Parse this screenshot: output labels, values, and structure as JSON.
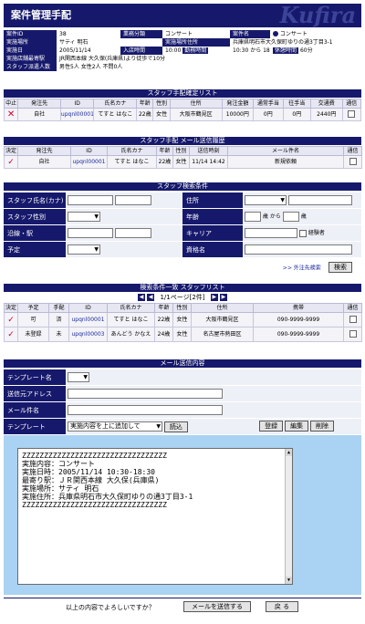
{
  "page": {
    "title": "案件管理手配",
    "logo_text": "Kufira"
  },
  "case_info": {
    "case_id_label": "案件ID",
    "case_id": "38",
    "business_type_label": "業務分類",
    "business_type": "コンサート",
    "case_name_label": "案件名",
    "case_name": "コンサート",
    "venue_label": "実施場所",
    "venue": "サティ 明石",
    "venue_address_label": "実施場所住所",
    "venue_address": "兵庫県明石市大久保町ゆりの通3丁目3-1",
    "date_label": "実施日",
    "date": "2005/11/14",
    "entry_time_label": "入店時間",
    "entry_time": "10:00",
    "work_time_label": "勤務時間",
    "work_time": "10:30 から 18:30",
    "break_time_label": "休憩時間",
    "break_time": "60分",
    "station_label": "実施店舗最寄駅",
    "station": "JR関西本線 大久保(兵庫県)より徒歩で10分",
    "staff_count_label": "スタッフ派遣人数",
    "staff_count": "男性5人 女性2人 不問0人"
  },
  "confirmed_list": {
    "title": "スタッフ手配確定リスト",
    "headers": [
      "中止",
      "発注先",
      "ID",
      "氏名カナ",
      "年齢",
      "性別",
      "住所",
      "発注金額",
      "通常手当",
      "往手当",
      "交通費",
      "通信"
    ],
    "rows": [
      {
        "vendor": "自社",
        "id": "upqnl00001",
        "name": "てすと はなこ",
        "age": "22歳",
        "sex": "女性",
        "address": "大阪市鶴見区",
        "amount": "10000円",
        "allowance": "0円",
        "trip": "0円",
        "transport": "2440円"
      }
    ]
  },
  "mail_history": {
    "title": "スタッフ手配 メール送信履歴",
    "headers": [
      "決定",
      "発注先",
      "ID",
      "氏名カナ",
      "年齢",
      "性別",
      "送信時刻",
      "メール件名",
      "通信"
    ],
    "rows": [
      {
        "vendor": "自社",
        "id": "upqnl00001",
        "name": "てすと はなこ",
        "age": "22歳",
        "sex": "女性",
        "sent": "11/14 14:42",
        "subject": "新規依頼"
      }
    ]
  },
  "search": {
    "title": "スタッフ検索条件",
    "name_label": "スタッフ氏名(カナ)",
    "address_label": "住所",
    "sex_label": "スタッフ性別",
    "age_label": "年齢",
    "age_from": "歳 から",
    "age_to": "歳",
    "station_label": "沿線・駅",
    "career_label": "キャリア",
    "experienced": "経験者",
    "reserve_label": "予定",
    "qualification_label": "資格名",
    "outside_link": ">> 外注先検索",
    "search_button": "検索"
  },
  "results": {
    "title": "検索条件一致 スタッフリスト",
    "pager": "1/1ページ[2件]",
    "headers": [
      "決定",
      "予定",
      "手配",
      "ID",
      "氏名カナ",
      "年齢",
      "性別",
      "住所",
      "携帯",
      "通信"
    ],
    "rows": [
      {
        "plan": "可",
        "arranged": "済",
        "id": "upqnl00001",
        "name": "てすと はなこ",
        "age": "22歳",
        "sex": "女性",
        "address": "大阪市鶴見区",
        "mobile": "090-9999-9999"
      },
      {
        "plan": "未登録",
        "arranged": "未",
        "id": "upqnl00003",
        "name": "あんどう かなえ",
        "age": "24歳",
        "sex": "女性",
        "address": "名古屋市熱田区",
        "mobile": "090-9999-9999"
      }
    ]
  },
  "mail_form": {
    "title": "メール送信内容",
    "template_name_label": "テンプレート名",
    "address_label": "送信元アドレス",
    "subject_label": "メール件名",
    "template_label": "テンプレート",
    "template_select": "実施内容を上に追加して",
    "load_button": "読込",
    "register_button": "登録",
    "edit_button": "編集",
    "delete_button": "削除",
    "body_lines": [
      "ZZZZZZZZZZZZZZZZZZZZZZZZZZZZZZZZZ",
      "実施内容：コンサート",
      "実施日時：2005/11/14  10:30-18:30",
      "最寄り駅：ＪＲ関西本線 大久保(兵庫県)",
      "実施場所：サティ 明石",
      "実施住所：兵庫県明石市大久保町ゆりの通3丁目3-1",
      "ZZZZZZZZZZZZZZZZZZZZZZZZZZZZZZZZZ"
    ]
  },
  "footer": {
    "confirm_text": "以上の内容でよろしいですか？",
    "send_button": "メールを送信する",
    "back_button": "戻 る"
  },
  "colors": {
    "navy": "#16196b",
    "panel": "#aad2f2",
    "check": "#d4002a"
  }
}
